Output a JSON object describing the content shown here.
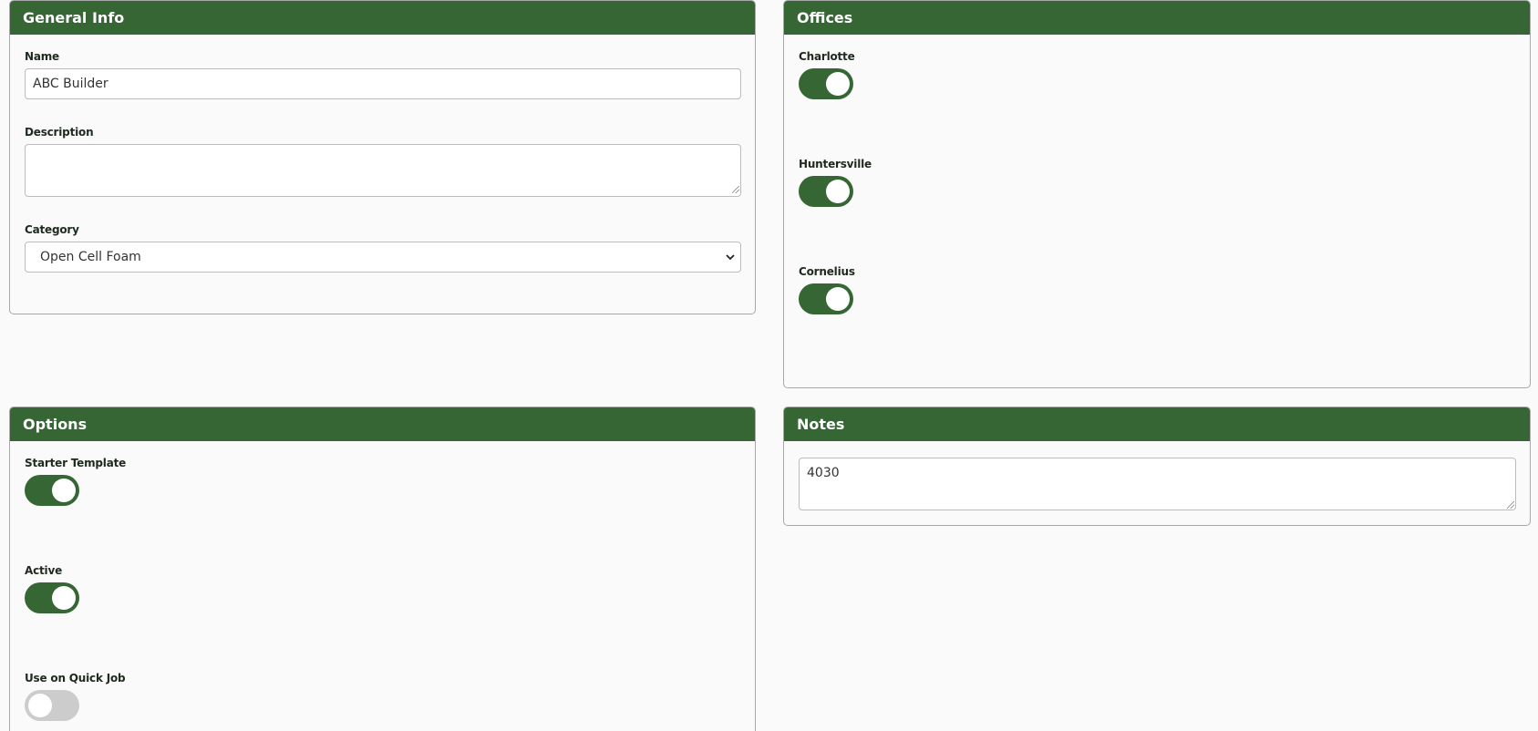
{
  "general_info": {
    "title": "General Info",
    "name_label": "Name",
    "name_value": "ABC Builder",
    "description_label": "Description",
    "description_value": "",
    "category_label": "Category",
    "category_value": "Open Cell Foam"
  },
  "offices": {
    "title": "Offices",
    "items": [
      {
        "label": "Charlotte",
        "on": true
      },
      {
        "label": "Huntersville",
        "on": true
      },
      {
        "label": "Cornelius",
        "on": true
      }
    ]
  },
  "options": {
    "title": "Options",
    "items": [
      {
        "label": "Starter Template",
        "on": true
      },
      {
        "label": "Active",
        "on": true
      },
      {
        "label": "Use on Quick Job",
        "on": false
      }
    ]
  },
  "notes": {
    "title": "Notes",
    "value": "4030"
  },
  "colors": {
    "accent": "#356633",
    "toggle_off": "#cccccc"
  }
}
